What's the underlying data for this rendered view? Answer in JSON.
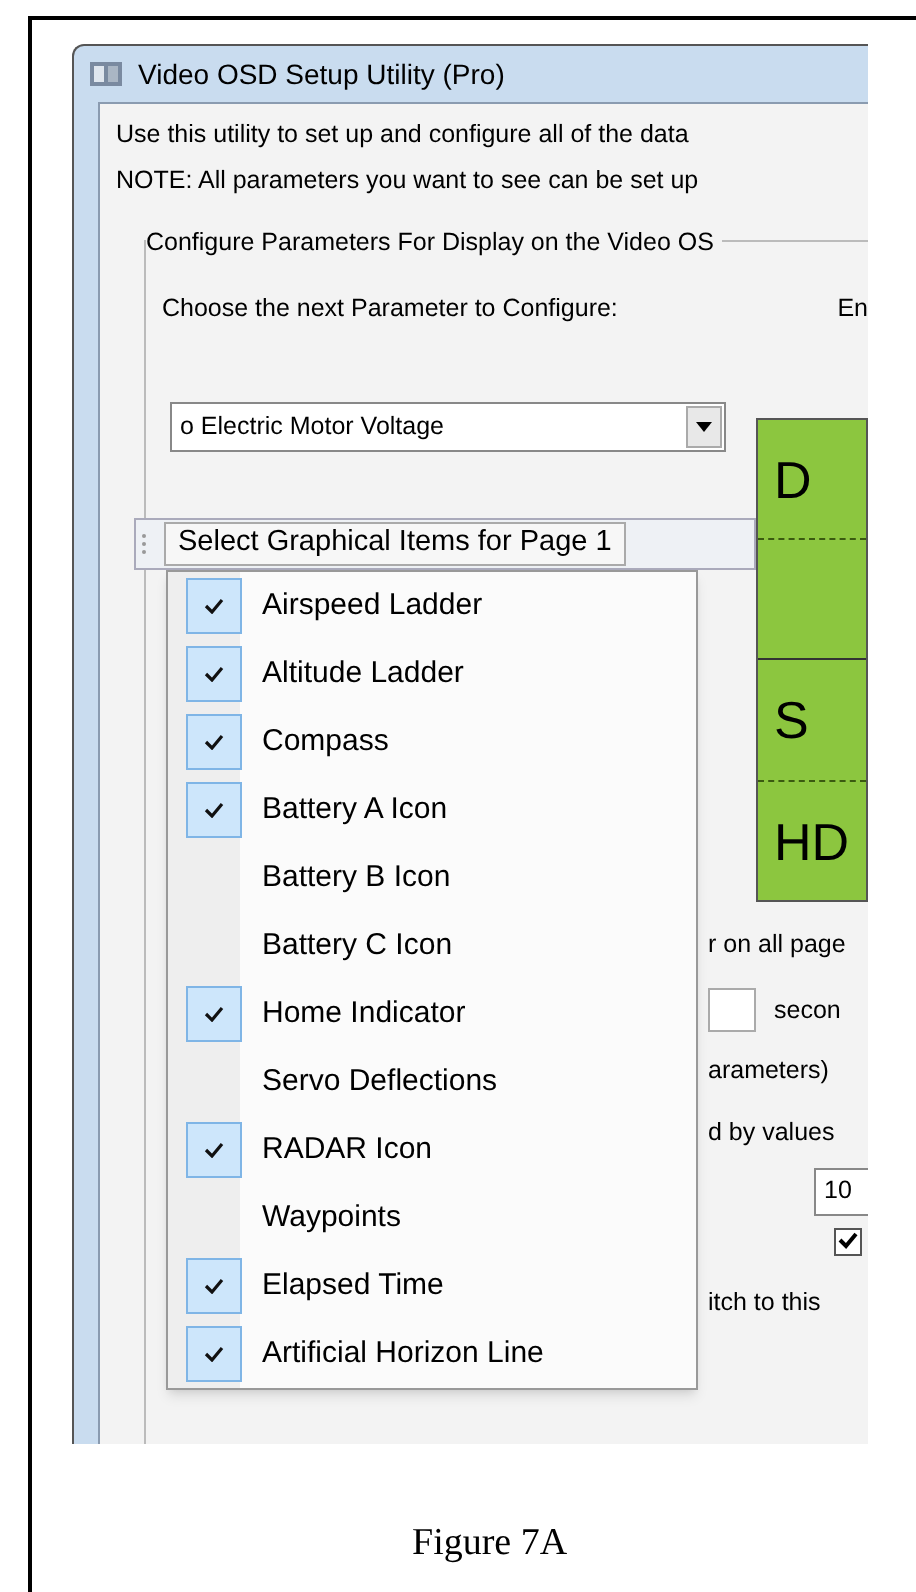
{
  "window": {
    "title": "Video OSD Setup Utility (Pro)"
  },
  "intro_lines": [
    "Use this utility to set up and configure all of the data",
    "NOTE:  All parameters you want to see can be set up"
  ],
  "group": {
    "title": "Configure Parameters For Display on the Video OS",
    "prompt": "Choose the next Parameter to Configure:",
    "column_2_label": "En",
    "parameter_dropdown": {
      "value": "o Electric Motor Voltage"
    }
  },
  "preview_panel": {
    "labels": [
      "D",
      "S",
      "HD"
    ]
  },
  "fragments": {
    "line_1": "r on all page",
    "seconds_label": "secon",
    "line_3": "arameters)",
    "line_4": "d by values",
    "number_field": {
      "value": "10"
    },
    "checkbox": {
      "checked": true
    },
    "line_7": "itch to this"
  },
  "popup": {
    "title": "Select Graphical Items for Page 1",
    "items": [
      {
        "label": "Airspeed Ladder",
        "checked": true
      },
      {
        "label": "Altitude Ladder",
        "checked": true
      },
      {
        "label": "Compass",
        "checked": true
      },
      {
        "label": "Battery A Icon",
        "checked": true
      },
      {
        "label": "Battery B Icon",
        "checked": false
      },
      {
        "label": "Battery C Icon",
        "checked": false
      },
      {
        "label": "Home Indicator",
        "checked": true
      },
      {
        "label": "Servo Deflections",
        "checked": false
      },
      {
        "label": "RADAR Icon",
        "checked": true
      },
      {
        "label": "Waypoints",
        "checked": false
      },
      {
        "label": "Elapsed Time",
        "checked": true
      },
      {
        "label": "Artificial Horizon Line",
        "checked": true
      }
    ]
  },
  "caption": "Figure 7A"
}
